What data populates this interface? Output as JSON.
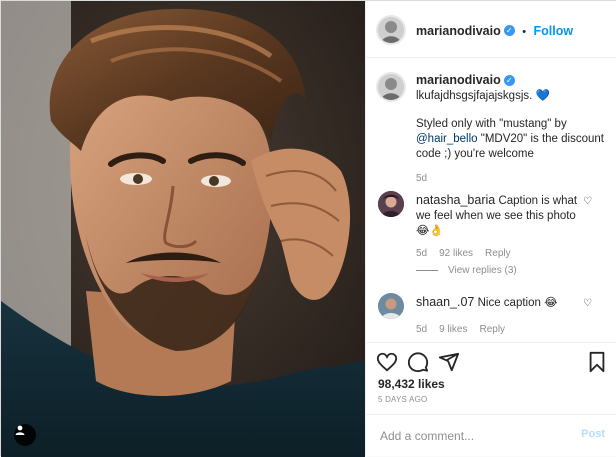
{
  "post": {
    "username": "marianodivaio",
    "follow_label": "Follow",
    "separator": "•",
    "verified_glyph": "✓"
  },
  "caption": {
    "username": "marianodivaio",
    "line1": "lkufajdhsgsjfajajskgsjs.",
    "heart_emoji": "💙",
    "line2": "Styled only with \"mustang\" by",
    "mention": "@hair_bello",
    "line3_rest": " \"MDV20\" is the discount",
    "line4": "code ;) you're welcome",
    "time": "5d"
  },
  "comments": [
    {
      "username": "natasha_baria",
      "text": "Caption is what we feel when we see this photo",
      "emoji": "😂👌",
      "time": "5d",
      "likes": "92 likes",
      "reply": "Reply",
      "view_replies": "View replies (3)"
    },
    {
      "username": "shaan_.07",
      "text": "Nice caption",
      "emoji": "😂",
      "time": "5d",
      "likes": "9 likes",
      "reply": "Reply"
    }
  ],
  "stats": {
    "likes": "98,432 likes",
    "date": "5 DAYS AGO"
  },
  "composer": {
    "placeholder": "Add a comment...",
    "post_label": "Post"
  },
  "icons": [
    "user-tag-icon",
    "verified-badge-icon",
    "heart-icon",
    "comment-icon",
    "share-icon",
    "bookmark-icon"
  ],
  "colors": {
    "accent": "#0095f6",
    "verified": "#3897f0",
    "border": "#dbdbdb",
    "muted": "#8e8e8e"
  }
}
